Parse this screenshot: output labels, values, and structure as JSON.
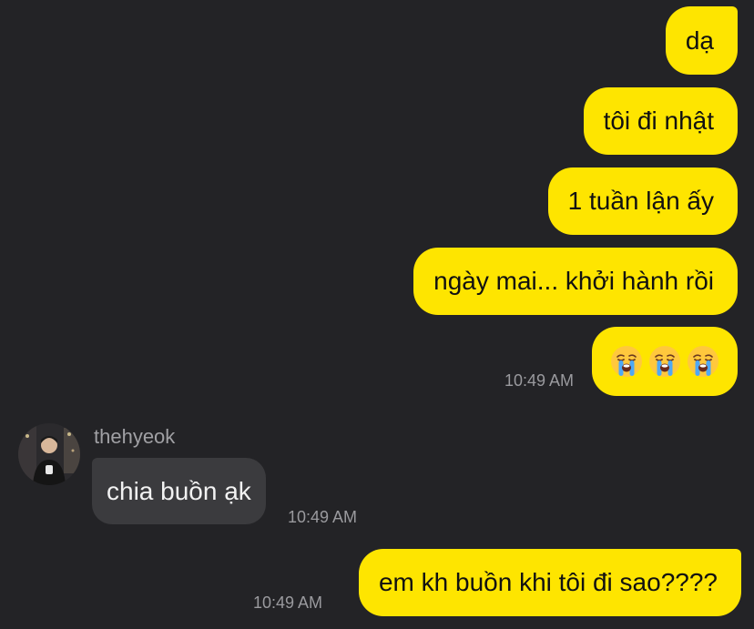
{
  "chat": {
    "outgoing_1": "dạ",
    "outgoing_2": "tôi đi nhật",
    "outgoing_3": "1 tuần lận ấy",
    "outgoing_4": "ngày mai... khởi hành rồi",
    "outgoing_5_emojis": [
      "crying-face",
      "crying-face",
      "crying-face"
    ],
    "outgoing_5_time": "10:49 AM",
    "contact": {
      "name": "thehyeok"
    },
    "incoming_1": "chia buồn ạk",
    "incoming_1_time": "10:49 AM",
    "outgoing_6": "em kh buồn khi tôi đi sao????",
    "outgoing_6_time": "10:49 AM"
  },
  "colors": {
    "background": "#232326",
    "outgoing_bubble": "#FEE500",
    "incoming_bubble": "#3b3b3e",
    "timestamp": "#9a9a9e"
  }
}
